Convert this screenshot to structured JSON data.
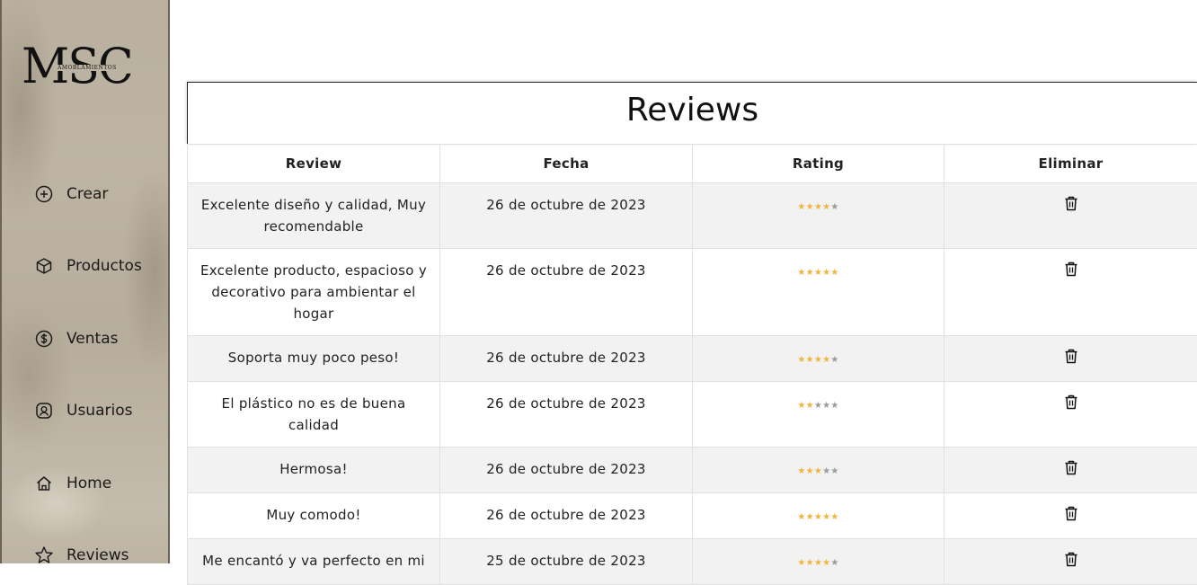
{
  "brand": {
    "logo_text": "MSC",
    "logo_subtext": "AMOBLAMIENTOS"
  },
  "nav": {
    "items": [
      {
        "label": "Crear",
        "icon": "plus-circle-icon"
      },
      {
        "label": "Productos",
        "icon": "box-icon"
      },
      {
        "label": "Ventas",
        "icon": "dollar-circle-icon"
      },
      {
        "label": "Usuarios",
        "icon": "user-square-icon"
      },
      {
        "label": "Home",
        "icon": "home-icon"
      },
      {
        "label": "Reviews",
        "icon": "star-outline-icon"
      }
    ]
  },
  "page": {
    "title": "Reviews"
  },
  "table": {
    "headers": [
      "Review",
      "Fecha",
      "Rating",
      "Eliminar"
    ],
    "rows": [
      {
        "review": "Excelente diseño y calidad, Muy recomendable",
        "fecha": "26 de octubre de 2023",
        "rating": 4
      },
      {
        "review": "Excelente producto, espacioso y decorativo para ambientar el hogar",
        "fecha": "26 de octubre de 2023",
        "rating": 5
      },
      {
        "review": "Soporta muy poco peso!",
        "fecha": "26 de octubre de 2023",
        "rating": 4
      },
      {
        "review": "El plástico no es de buena calidad",
        "fecha": "26 de octubre de 2023",
        "rating": 2
      },
      {
        "review": "Hermosa!",
        "fecha": "26 de octubre de 2023",
        "rating": 3
      },
      {
        "review": "Muy comodo!",
        "fecha": "26 de octubre de 2023",
        "rating": 5
      },
      {
        "review": "Me encantó y va perfecto en mi",
        "fecha": "25 de octubre de 2023",
        "rating": 4
      }
    ],
    "max_rating": 5
  },
  "colors": {
    "star_on": "#f3b23b",
    "star_off": "#9a9a9a",
    "row_alt": "#f2f2f2"
  }
}
